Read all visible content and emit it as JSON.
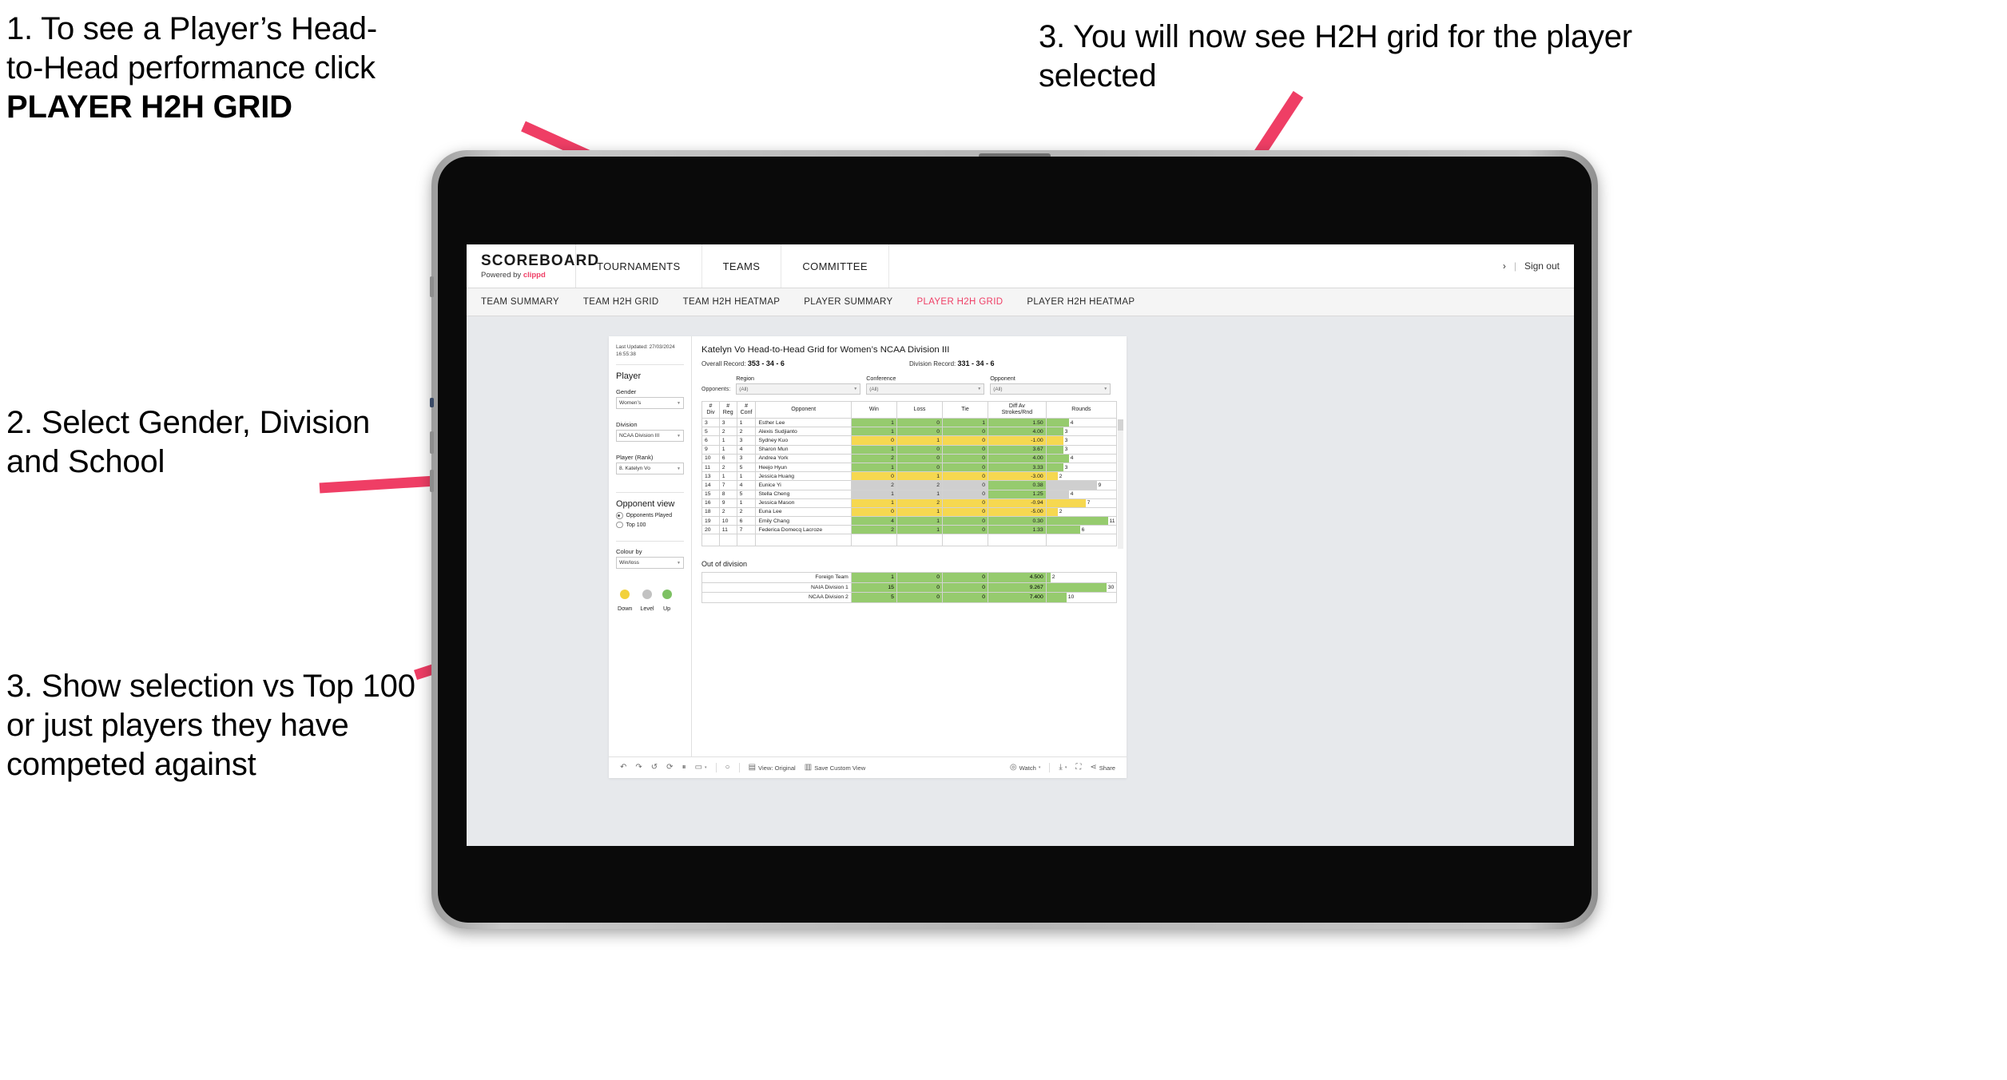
{
  "annotations": [
    {
      "id": "annot-1",
      "line1": "1. To see a Player’s Head-",
      "line2": "to-Head performance click",
      "bold": "PLAYER H2H GRID"
    },
    {
      "id": "annot-2",
      "text": "2. Select Gender, Division and School"
    },
    {
      "id": "annot-3",
      "text": "3. Show selection vs Top 100 or just players they have competed against"
    },
    {
      "id": "annot-4",
      "text": "3. You will now see H2H grid for the player selected"
    }
  ],
  "app": {
    "brand": {
      "title": "SCOREBOARD",
      "powered_prefix": "Powered by ",
      "powered_brand": "clippd"
    },
    "topnav": [
      "TOURNAMENTS",
      "TEAMS",
      "COMMITTEE"
    ],
    "header_right": {
      "chevron": "›",
      "separator": "|",
      "sign_out": "Sign out"
    },
    "subnav": [
      {
        "label": "TEAM SUMMARY",
        "active": false
      },
      {
        "label": "TEAM H2H GRID",
        "active": false
      },
      {
        "label": "TEAM H2H HEATMAP",
        "active": false
      },
      {
        "label": "PLAYER SUMMARY",
        "active": false
      },
      {
        "label": "PLAYER H2H GRID",
        "active": true
      },
      {
        "label": "PLAYER H2H HEATMAP",
        "active": false
      }
    ],
    "accent": "#ef3e65"
  },
  "filters": {
    "last_updated": "Last Updated: 27/03/2024 16:55:38",
    "heading": "Player",
    "gender": {
      "label": "Gender",
      "value": "Women’s"
    },
    "division": {
      "label": "Division",
      "value": "NCAA Division III"
    },
    "player": {
      "label": "Player (Rank)",
      "value": "8. Katelyn Vo"
    },
    "opponent_view": {
      "heading": "Opponent view",
      "options": [
        {
          "label": "Opponents Played",
          "selected": true
        },
        {
          "label": "Top 100",
          "selected": false
        }
      ]
    },
    "colour_by": {
      "label": "Colour by",
      "value": "Win/loss"
    },
    "legend": [
      {
        "label": "Down",
        "color": "#f2d13c"
      },
      {
        "label": "Level",
        "color": "#c2c2c2"
      },
      {
        "label": "Up",
        "color": "#7dc163"
      }
    ]
  },
  "dashboard": {
    "title": "Katelyn Vo Head-to-Head Grid for Women’s NCAA Division III",
    "overall_record_label": "Overall Record:",
    "overall_record": "353 - 34 - 6",
    "division_record_label": "Division Record:",
    "division_record": "331 - 34 - 6",
    "opponents_label": "Opponents:",
    "opponent_filters": [
      {
        "label": "Region",
        "value": "(All)"
      },
      {
        "label": "Conference",
        "value": "(All)"
      },
      {
        "label": "Opponent",
        "value": "(All)"
      }
    ]
  },
  "chart_data": {
    "type": "table",
    "title": "Katelyn Vo Head-to-Head Grid for Women’s NCAA Division III",
    "columns": [
      "# Div",
      "# Reg",
      "# Conf",
      "Opponent",
      "Win",
      "Loss",
      "Tie",
      "Diff Av Strokes/Rnd",
      "Rounds"
    ],
    "rows": [
      {
        "div": "3",
        "reg": "3",
        "conf": "1",
        "opponent": "Esther Lee",
        "win": "1",
        "loss": "0",
        "tie": "1",
        "diff": "1.50",
        "rounds": 4,
        "colour": "green"
      },
      {
        "div": "5",
        "reg": "2",
        "conf": "2",
        "opponent": "Alexis Sudjianto",
        "win": "1",
        "loss": "0",
        "tie": "0",
        "diff": "4.00",
        "rounds": 3,
        "colour": "green"
      },
      {
        "div": "6",
        "reg": "1",
        "conf": "3",
        "opponent": "Sydney Kuo",
        "win": "0",
        "loss": "1",
        "tie": "0",
        "diff": "-1.00",
        "rounds": 3,
        "colour": "yellow"
      },
      {
        "div": "9",
        "reg": "1",
        "conf": "4",
        "opponent": "Sharon Mun",
        "win": "1",
        "loss": "0",
        "tie": "0",
        "diff": "3.67",
        "rounds": 3,
        "colour": "green"
      },
      {
        "div": "10",
        "reg": "6",
        "conf": "3",
        "opponent": "Andrea York",
        "win": "2",
        "loss": "0",
        "tie": "0",
        "diff": "4.00",
        "rounds": 4,
        "colour": "green"
      },
      {
        "div": "11",
        "reg": "2",
        "conf": "5",
        "opponent": "Heejo Hyun",
        "win": "1",
        "loss": "0",
        "tie": "0",
        "diff": "3.33",
        "rounds": 3,
        "colour": "green"
      },
      {
        "div": "13",
        "reg": "1",
        "conf": "1",
        "opponent": "Jessica Huang",
        "win": "0",
        "loss": "1",
        "tie": "0",
        "diff": "-3.00",
        "rounds": 2,
        "colour": "yellow"
      },
      {
        "div": "14",
        "reg": "7",
        "conf": "4",
        "opponent": "Eunice Yi",
        "win": "2",
        "loss": "2",
        "tie": "0",
        "diff": "0.38",
        "rounds": 9,
        "colour": "grey",
        "diff_colour": "green"
      },
      {
        "div": "15",
        "reg": "8",
        "conf": "5",
        "opponent": "Stella Cheng",
        "win": "1",
        "loss": "1",
        "tie": "0",
        "diff": "1.25",
        "rounds": 4,
        "colour": "grey",
        "diff_colour": "green"
      },
      {
        "div": "16",
        "reg": "9",
        "conf": "1",
        "opponent": "Jessica Mason",
        "win": "1",
        "loss": "2",
        "tie": "0",
        "diff": "-0.94",
        "rounds": 7,
        "colour": "yellow"
      },
      {
        "div": "18",
        "reg": "2",
        "conf": "2",
        "opponent": "Euna Lee",
        "win": "0",
        "loss": "1",
        "tie": "0",
        "diff": "-5.00",
        "rounds": 2,
        "colour": "yellow"
      },
      {
        "div": "19",
        "reg": "10",
        "conf": "6",
        "opponent": "Emily Chang",
        "win": "4",
        "loss": "1",
        "tie": "0",
        "diff": "0.30",
        "rounds": 11,
        "colour": "green"
      },
      {
        "div": "20",
        "reg": "11",
        "conf": "7",
        "opponent": "Federica Domecq Lacroze",
        "win": "2",
        "loss": "1",
        "tie": "0",
        "diff": "1.33",
        "rounds": 6,
        "colour": "green"
      }
    ],
    "rounds_max": 11,
    "out_of_division": {
      "title": "Out of division",
      "rows": [
        {
          "name": "Foreign Team",
          "win": "1",
          "loss": "0",
          "tie": "0",
          "diff": "4.500",
          "rounds": 2,
          "colour": "green"
        },
        {
          "name": "NAIA Division 1",
          "win": "15",
          "loss": "0",
          "tie": "0",
          "diff": "9.267",
          "rounds": 30,
          "colour": "green"
        },
        {
          "name": "NCAA Division 2",
          "win": "5",
          "loss": "0",
          "tie": "0",
          "diff": "7.400",
          "rounds": 10,
          "colour": "green"
        }
      ],
      "rounds_max": 30
    },
    "colours": {
      "green": "#96cb6e",
      "yellow": "#f6d850",
      "grey": "#cfcfcf",
      "white": "#ffffff"
    }
  },
  "toolbar": {
    "undo": "↶",
    "redo": "↷",
    "revert": "↺",
    "refresh": "⤵",
    "pause": "⏸",
    "alerts": "○",
    "view_original": "View: Original",
    "save_custom_view": "Save Custom View",
    "watch": "Watch",
    "download": "",
    "fullscreen": "",
    "share": "Share",
    "caret": "▾"
  }
}
